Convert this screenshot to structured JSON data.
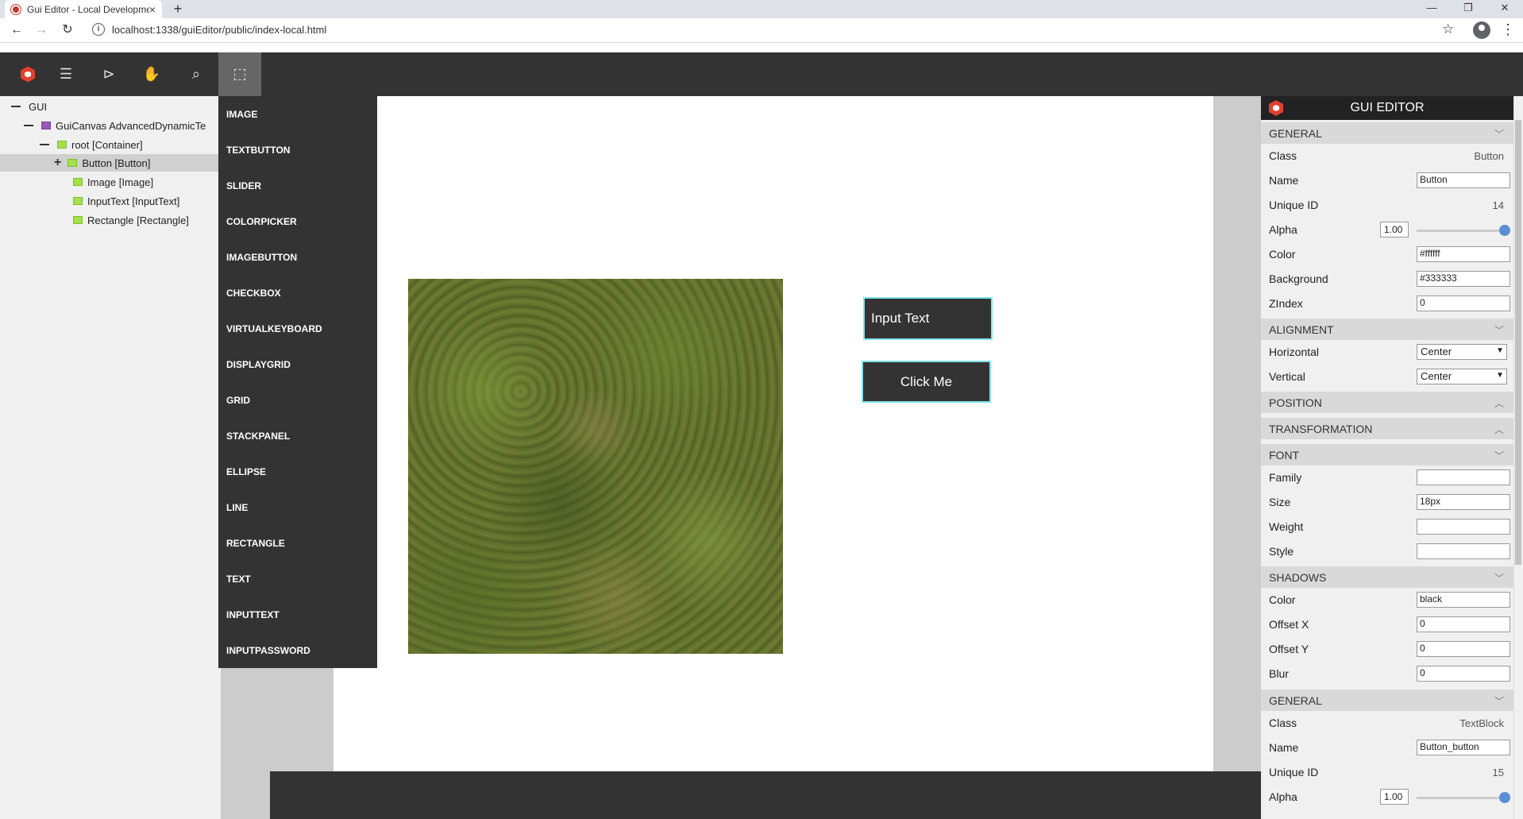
{
  "browser": {
    "tab_title": "Gui Editor - Local Development",
    "tab_close": "×",
    "new_tab": "+",
    "url": "localhost:1338/guiEditor/public/index-local.html",
    "back": "←",
    "forward": "→",
    "reload": "↻",
    "info": "i",
    "star": "☆",
    "kebab": "⋮",
    "minimize": "—",
    "restore": "❐",
    "close": "✕"
  },
  "toolbar": {
    "icons": [
      "logo-icon",
      "hamburger-menu-icon",
      "select-pointer-icon",
      "pan-hand-icon",
      "zoom-icon",
      "add-control-icon"
    ],
    "hamburger": "☰",
    "pointer": "⊳",
    "hand": "✋",
    "zoom": "⌕"
  },
  "tree": {
    "items": [
      {
        "label": "GUI"
      },
      {
        "label": "GuiCanvas AdvancedDynamicTe"
      },
      {
        "label": "root [Container]"
      },
      {
        "label": "Button [Button]",
        "expand": "+"
      },
      {
        "label": "Image [Image]"
      },
      {
        "label": "InputText [InputText]"
      },
      {
        "label": "Rectangle [Rectangle]"
      }
    ]
  },
  "add_menu": {
    "items": [
      "IMAGE",
      "TEXTBUTTON",
      "SLIDER",
      "COLORPICKER",
      "IMAGEBUTTON",
      "CHECKBOX",
      "VIRTUALKEYBOARD",
      "DISPLAYGRID",
      "GRID",
      "STACKPANEL",
      "ELLIPSE",
      "LINE",
      "RECTANGLE",
      "TEXT",
      "INPUTTEXT",
      "INPUTPASSWORD"
    ]
  },
  "canvas": {
    "input_text": "Input Text",
    "click_me": "Click Me"
  },
  "props": {
    "title": "GUI EDITOR",
    "sections": {
      "general": "GENERAL",
      "alignment": "ALIGNMENT",
      "position": "POSITION",
      "transformation": "TRANSFORMATION",
      "font": "FONT",
      "shadows": "SHADOWS",
      "general2": "GENERAL"
    },
    "chev_down": "﹀",
    "chev_up": "︿",
    "general": {
      "class_label": "Class",
      "class_value": "Button",
      "name_label": "Name",
      "name_value": "Button",
      "uid_label": "Unique ID",
      "uid_value": "14",
      "alpha_label": "Alpha",
      "alpha_value": "1.00",
      "color_label": "Color",
      "color_value": "#ffffff",
      "bg_label": "Background",
      "bg_value": "#333333",
      "zindex_label": "ZIndex",
      "zindex_value": "0"
    },
    "alignment": {
      "h_label": "Horizontal",
      "h_value": "Center",
      "v_label": "Vertical",
      "v_value": "Center"
    },
    "font": {
      "family_label": "Family",
      "family_value": "",
      "size_label": "Size",
      "size_value": "18px",
      "weight_label": "Weight",
      "weight_value": "",
      "style_label": "Style",
      "style_value": ""
    },
    "shadows": {
      "color_label": "Color",
      "color_value": "black",
      "ox_label": "Offset X",
      "ox_value": "0",
      "oy_label": "Offset Y",
      "oy_value": "0",
      "blur_label": "Blur",
      "blur_value": "0"
    },
    "general2": {
      "class_label": "Class",
      "class_value": "TextBlock",
      "name_label": "Name",
      "name_value": "Button_button",
      "uid_label": "Unique ID",
      "uid_value": "15",
      "alpha_label": "Alpha",
      "alpha_value": "1.00"
    }
  }
}
